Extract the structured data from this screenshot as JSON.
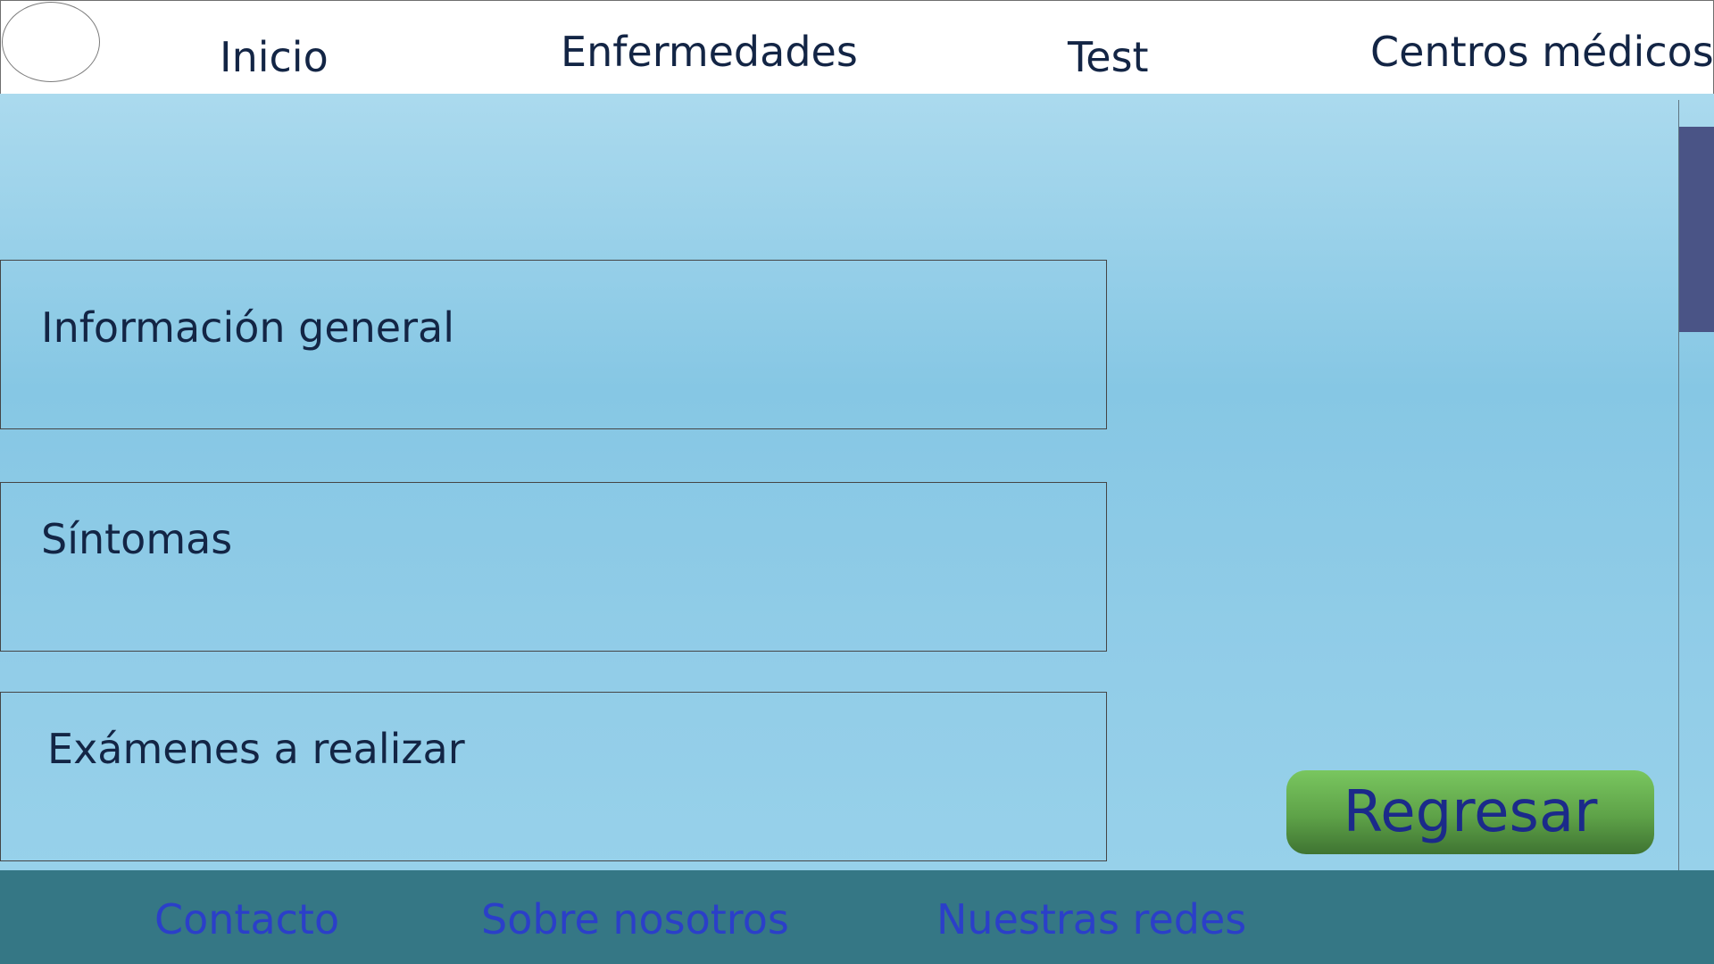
{
  "header": {
    "nav": {
      "inicio": "Inicio",
      "enfermedades": "Enfermedades",
      "test": "Test",
      "centros": "Centros médicos"
    }
  },
  "main": {
    "sections": [
      {
        "label": "Información general"
      },
      {
        "label": "Síntomas"
      },
      {
        "label": "Exámenes a realizar"
      }
    ],
    "back_button": "Regresar"
  },
  "footer": {
    "links": [
      "Contacto",
      "Sobre nosotros",
      "Nuestras redes"
    ]
  },
  "colors": {
    "header_bg": "#ffffff",
    "nav_text": "#132545",
    "main_gradient_top": "#abdaee",
    "main_gradient_mid": "#86c7e4",
    "button_green": "#5ea248",
    "button_text": "#1b2a8a",
    "scroll_thumb": "#4a5486",
    "footer_bg": "#357785",
    "footer_link": "#2b3fc9"
  }
}
